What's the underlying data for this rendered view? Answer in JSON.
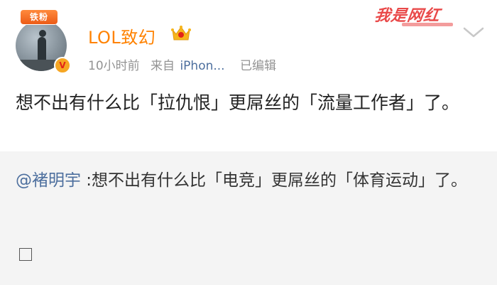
{
  "post": {
    "fan_badge": "铁粉",
    "author": "LOL致幻",
    "time": "10小时前",
    "from_label": "来自",
    "device": "iPhon...",
    "edited": "已编辑",
    "text": "想不出有什么比「拉仇恨」更屌丝的「流量工作者」了。",
    "watermark": "我是网红"
  },
  "repost": {
    "mention": "@褚明宇",
    "text": " :想不出有什么比「电竞」更屌丝的「体育运动」了。"
  },
  "colors": {
    "username": "#ff8200",
    "link": "#4d6f9e",
    "meta": "#939393",
    "repost_bg": "#f4f4f4"
  },
  "icons": {
    "crown": "vip-crown-icon",
    "verify": "verified-badge-icon",
    "chevron": "chevron-down-icon",
    "image": "image-placeholder-icon"
  }
}
